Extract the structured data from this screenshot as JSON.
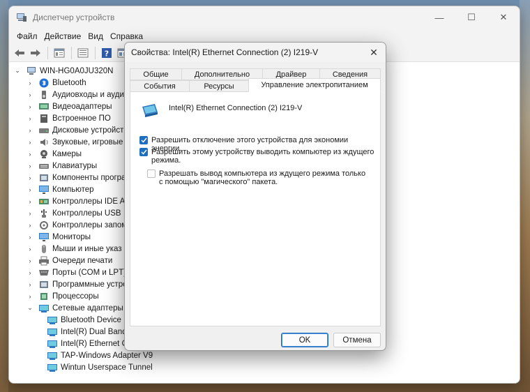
{
  "main_window": {
    "title": "Диспетчер устройств",
    "controls": {
      "minimize": "—",
      "maximize": "☐",
      "close": "✕"
    }
  },
  "menu": [
    "Файл",
    "Действие",
    "Вид",
    "Справка"
  ],
  "toolbar_icons": [
    "back-arrow-icon",
    "forward-arrow-icon",
    "properties-icon",
    "device-list-icon",
    "help-icon",
    "view-icon"
  ],
  "tree": {
    "root": "WIN-HG0A0JU320N",
    "categories": [
      "Bluetooth",
      "Аудиовходы и аудио",
      "Видеоадаптеры",
      "Встроенное ПО",
      "Дисковые устройств",
      "Звуковые, игровые и",
      "Камеры",
      "Клавиатуры",
      "Компоненты програ",
      "Компьютер",
      "Контроллеры IDE ATA",
      "Контроллеры USB",
      "Контроллеры запом",
      "Мониторы",
      "Мыши и иные указ",
      "Очереди печати",
      "Порты (COM и LPT)",
      "Программные устро",
      "Процессоры",
      "Сетевые адаптеры"
    ],
    "network_children": [
      "Bluetooth Device",
      "Intel(R) Dual Band",
      "Intel(R) Ethernet C",
      "TAP-Windows Adapter V9",
      "Wintun Userspace Tunnel"
    ]
  },
  "dialog": {
    "title": "Свойства: Intel(R) Ethernet Connection (2) I219-V",
    "tabs_row1": [
      "Общие",
      "Дополнительно",
      "Драйвер",
      "Сведения"
    ],
    "tabs_row2": [
      "События",
      "Ресурсы",
      "Управление электропитанием"
    ],
    "active_tab": "Управление электропитанием",
    "device_name": "Intel(R) Ethernet Connection (2) I219-V",
    "options": [
      {
        "label": "Разрешить отключение этого устройства для экономии энергии.",
        "checked": true
      },
      {
        "label": "Разрешить этому устройству выводить компьютер из ждущего режима.",
        "checked": true
      },
      {
        "label": "Разрешать вывод компьютера из ждущего режима только с помощью \"магического\" пакета.",
        "checked": false
      }
    ],
    "ok_label": "OK",
    "cancel_label": "Отмена"
  },
  "colors": {
    "accent": "#1f6fbf",
    "window_bg": "#f3f3f3"
  }
}
